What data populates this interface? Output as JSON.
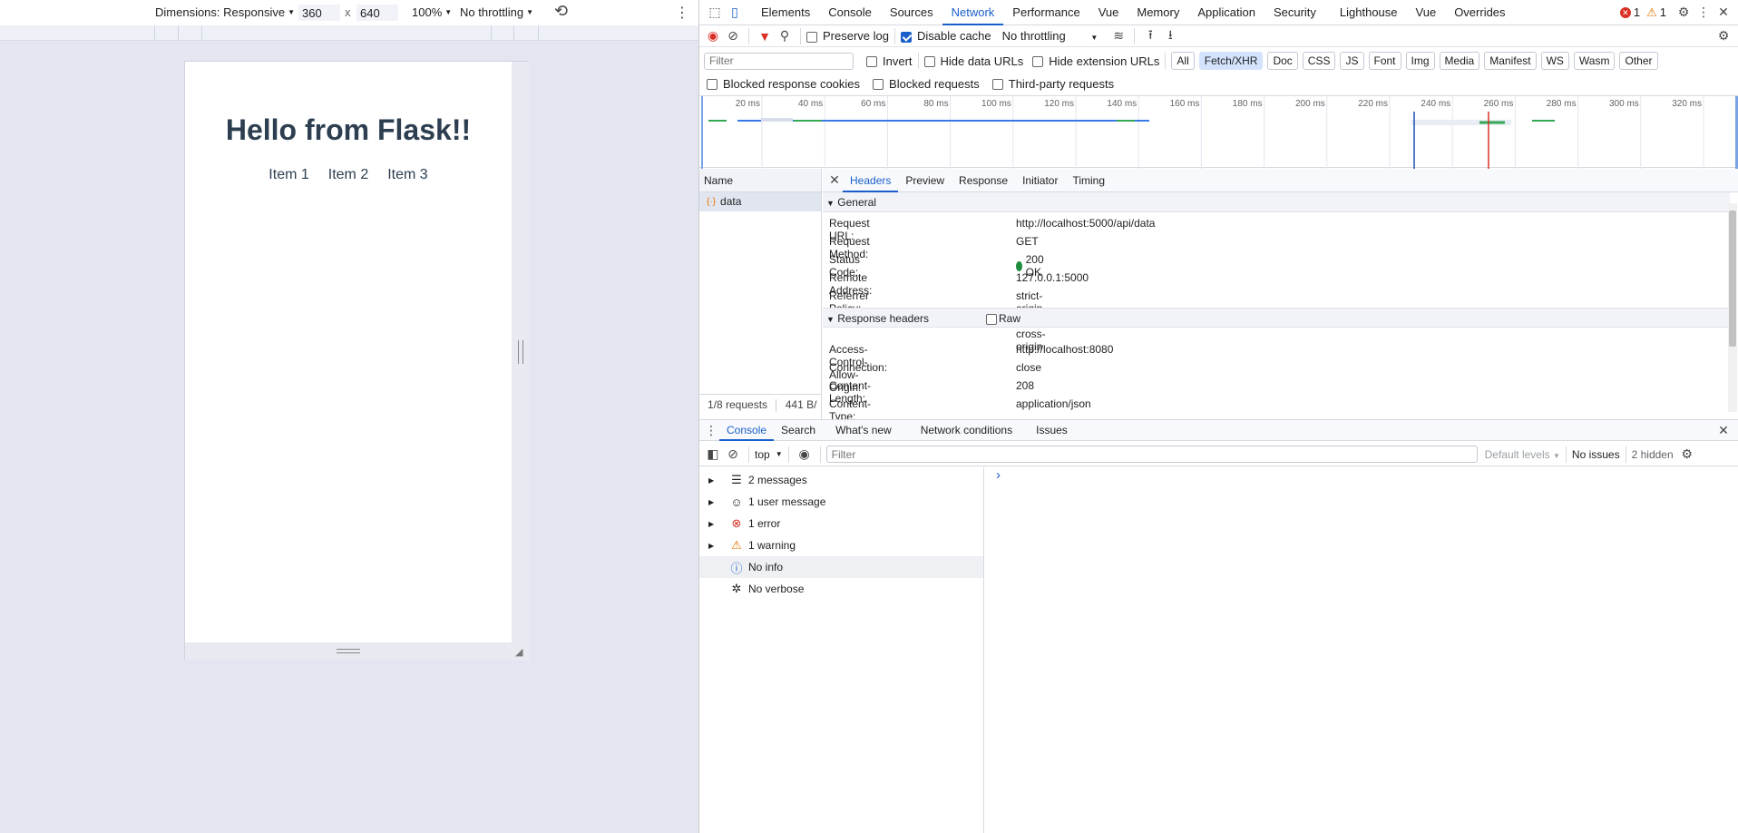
{
  "emulation": {
    "dimensions_label": "Dimensions: Responsive",
    "width_value": "360",
    "times": "x",
    "height_value": "640",
    "zoom": "100%",
    "throttling": "No throttling"
  },
  "page": {
    "heading": "Hello from Flask!!",
    "items": [
      "Item 1",
      "Item 2",
      "Item 3"
    ]
  },
  "devtools": {
    "tabs": [
      "Elements",
      "Console",
      "Sources",
      "Network",
      "Performance",
      "Vue",
      "Memory",
      "Application",
      "Security",
      "Lighthouse",
      "Vue",
      "Overrides"
    ],
    "active_tab": "Network",
    "error_count": "1",
    "warning_count": "1",
    "network": {
      "preserve_log": "Preserve log",
      "disable_cache": "Disable cache",
      "throttling": "No throttling",
      "filter_placeholder": "Filter",
      "invert": "Invert",
      "hide_data_urls": "Hide data URLs",
      "hide_extension_urls": "Hide extension URLs",
      "types": [
        "All",
        "Fetch/XHR",
        "Doc",
        "CSS",
        "JS",
        "Font",
        "Img",
        "Media",
        "Manifest",
        "WS",
        "Wasm",
        "Other"
      ],
      "active_type": "Fetch/XHR",
      "blocked_response_cookies": "Blocked response cookies",
      "blocked_requests": "Blocked requests",
      "third_party_requests": "Third-party requests",
      "timeline_ticks": [
        "20 ms",
        "40 ms",
        "60 ms",
        "80 ms",
        "100 ms",
        "120 ms",
        "140 ms",
        "160 ms",
        "180 ms",
        "200 ms",
        "220 ms",
        "240 ms",
        "260 ms",
        "280 ms",
        "300 ms",
        "320 ms"
      ],
      "name_header": "Name",
      "request_name": "data",
      "detail_tabs": [
        "Headers",
        "Preview",
        "Response",
        "Initiator",
        "Timing"
      ],
      "active_detail_tab": "Headers",
      "general_title": "General",
      "general": [
        {
          "k": "Request URL:",
          "v": "http://localhost:5000/api/data"
        },
        {
          "k": "Request Method:",
          "v": "GET"
        },
        {
          "k": "Status Code:",
          "v": "200 OK"
        },
        {
          "k": "Remote Address:",
          "v": "127.0.0.1:5000"
        },
        {
          "k": "Referrer Policy:",
          "v": "strict-origin-when-cross-origin"
        }
      ],
      "response_headers_title": "Response headers",
      "raw_label": "Raw",
      "response_headers": [
        {
          "k": "Access-Control-Allow-Origin:",
          "v": "http://localhost:8080"
        },
        {
          "k": "Connection:",
          "v": "close"
        },
        {
          "k": "Content-Length:",
          "v": "208"
        },
        {
          "k": "Content-Type:",
          "v": "application/json"
        }
      ],
      "summary_requests": "1/8 requests",
      "summary_size": "441 B/",
      "status_color": "#1e8e3e"
    },
    "drawer": {
      "tabs": [
        "Console",
        "Search",
        "What's new",
        "Network conditions",
        "Issues"
      ],
      "active_tab": "Console",
      "context": "top",
      "filter_placeholder": "Filter",
      "levels": "Default levels",
      "no_issues": "No issues",
      "hidden": "2 hidden",
      "sidebar": [
        {
          "label": "2 messages",
          "icon": "list-icon"
        },
        {
          "label": "1 user message",
          "icon": "user-icon"
        },
        {
          "label": "1 error",
          "icon": "error-icon"
        },
        {
          "label": "1 warning",
          "icon": "warning-icon"
        },
        {
          "label": "No info",
          "icon": "info-icon"
        },
        {
          "label": "No verbose",
          "icon": "bug-icon"
        }
      ],
      "prompt": "›"
    }
  }
}
